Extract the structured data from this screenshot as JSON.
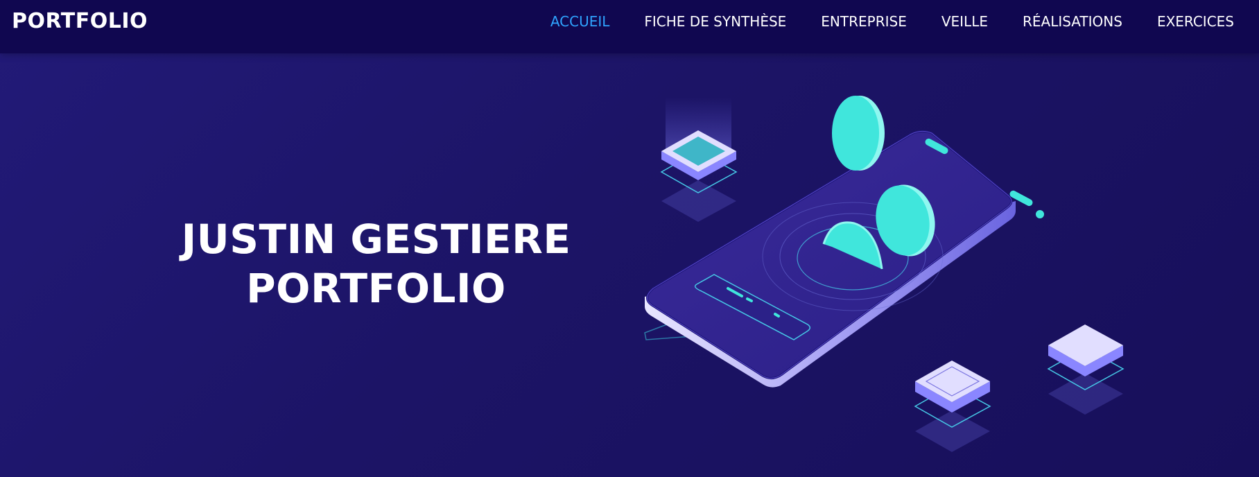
{
  "header": {
    "brand": "PORTFOLIO",
    "nav": [
      {
        "label": "ACCUEIL",
        "active": true
      },
      {
        "label": "FICHE DE SYNTHÈSE",
        "active": false
      },
      {
        "label": "ENTREPRISE",
        "active": false
      },
      {
        "label": "VEILLE",
        "active": false
      },
      {
        "label": "RÉALISATIONS",
        "active": false
      },
      {
        "label": "EXERCICES",
        "active": false
      }
    ]
  },
  "hero": {
    "line1": "JUSTIN GESTIERE",
    "line2": "PORTFOLIO"
  },
  "colors": {
    "nav_background": "#100750",
    "hero_background": "#1c1466",
    "nav_active": "#2fa4ff",
    "accent_turquoise": "#40e6dc",
    "device_lavender": "#c9c6ff"
  },
  "illustration": {
    "icon": "isometric-smartphone-illustration"
  }
}
